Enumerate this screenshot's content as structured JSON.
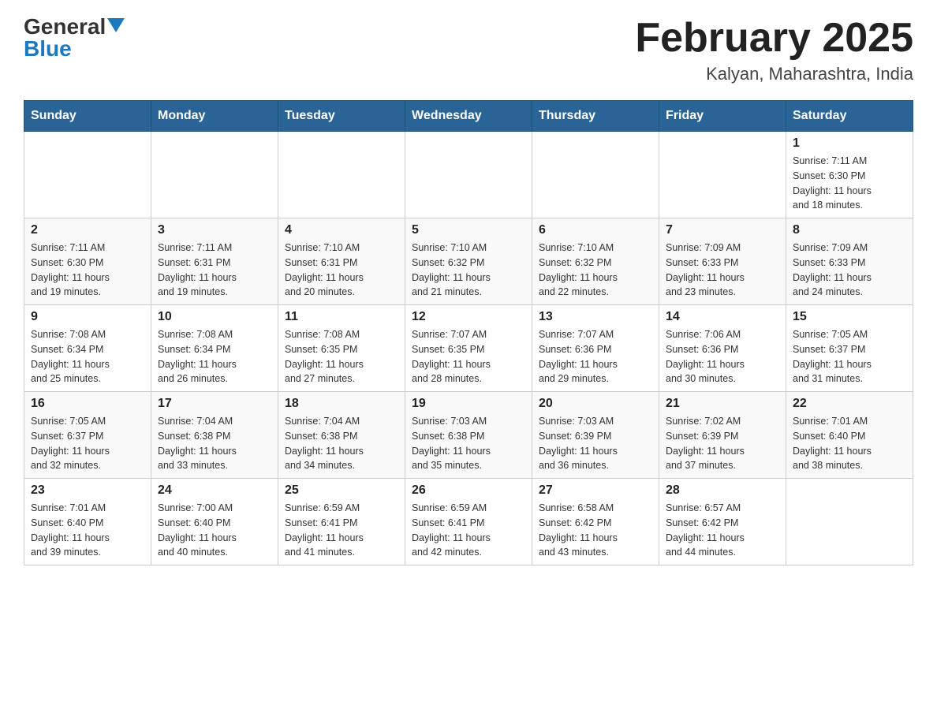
{
  "header": {
    "logo_general": "General",
    "logo_blue": "Blue",
    "title": "February 2025",
    "subtitle": "Kalyan, Maharashtra, India"
  },
  "days_of_week": [
    "Sunday",
    "Monday",
    "Tuesday",
    "Wednesday",
    "Thursday",
    "Friday",
    "Saturday"
  ],
  "weeks": [
    [
      {
        "day": "",
        "info": ""
      },
      {
        "day": "",
        "info": ""
      },
      {
        "day": "",
        "info": ""
      },
      {
        "day": "",
        "info": ""
      },
      {
        "day": "",
        "info": ""
      },
      {
        "day": "",
        "info": ""
      },
      {
        "day": "1",
        "info": "Sunrise: 7:11 AM\nSunset: 6:30 PM\nDaylight: 11 hours\nand 18 minutes."
      }
    ],
    [
      {
        "day": "2",
        "info": "Sunrise: 7:11 AM\nSunset: 6:30 PM\nDaylight: 11 hours\nand 19 minutes."
      },
      {
        "day": "3",
        "info": "Sunrise: 7:11 AM\nSunset: 6:31 PM\nDaylight: 11 hours\nand 19 minutes."
      },
      {
        "day": "4",
        "info": "Sunrise: 7:10 AM\nSunset: 6:31 PM\nDaylight: 11 hours\nand 20 minutes."
      },
      {
        "day": "5",
        "info": "Sunrise: 7:10 AM\nSunset: 6:32 PM\nDaylight: 11 hours\nand 21 minutes."
      },
      {
        "day": "6",
        "info": "Sunrise: 7:10 AM\nSunset: 6:32 PM\nDaylight: 11 hours\nand 22 minutes."
      },
      {
        "day": "7",
        "info": "Sunrise: 7:09 AM\nSunset: 6:33 PM\nDaylight: 11 hours\nand 23 minutes."
      },
      {
        "day": "8",
        "info": "Sunrise: 7:09 AM\nSunset: 6:33 PM\nDaylight: 11 hours\nand 24 minutes."
      }
    ],
    [
      {
        "day": "9",
        "info": "Sunrise: 7:08 AM\nSunset: 6:34 PM\nDaylight: 11 hours\nand 25 minutes."
      },
      {
        "day": "10",
        "info": "Sunrise: 7:08 AM\nSunset: 6:34 PM\nDaylight: 11 hours\nand 26 minutes."
      },
      {
        "day": "11",
        "info": "Sunrise: 7:08 AM\nSunset: 6:35 PM\nDaylight: 11 hours\nand 27 minutes."
      },
      {
        "day": "12",
        "info": "Sunrise: 7:07 AM\nSunset: 6:35 PM\nDaylight: 11 hours\nand 28 minutes."
      },
      {
        "day": "13",
        "info": "Sunrise: 7:07 AM\nSunset: 6:36 PM\nDaylight: 11 hours\nand 29 minutes."
      },
      {
        "day": "14",
        "info": "Sunrise: 7:06 AM\nSunset: 6:36 PM\nDaylight: 11 hours\nand 30 minutes."
      },
      {
        "day": "15",
        "info": "Sunrise: 7:05 AM\nSunset: 6:37 PM\nDaylight: 11 hours\nand 31 minutes."
      }
    ],
    [
      {
        "day": "16",
        "info": "Sunrise: 7:05 AM\nSunset: 6:37 PM\nDaylight: 11 hours\nand 32 minutes."
      },
      {
        "day": "17",
        "info": "Sunrise: 7:04 AM\nSunset: 6:38 PM\nDaylight: 11 hours\nand 33 minutes."
      },
      {
        "day": "18",
        "info": "Sunrise: 7:04 AM\nSunset: 6:38 PM\nDaylight: 11 hours\nand 34 minutes."
      },
      {
        "day": "19",
        "info": "Sunrise: 7:03 AM\nSunset: 6:38 PM\nDaylight: 11 hours\nand 35 minutes."
      },
      {
        "day": "20",
        "info": "Sunrise: 7:03 AM\nSunset: 6:39 PM\nDaylight: 11 hours\nand 36 minutes."
      },
      {
        "day": "21",
        "info": "Sunrise: 7:02 AM\nSunset: 6:39 PM\nDaylight: 11 hours\nand 37 minutes."
      },
      {
        "day": "22",
        "info": "Sunrise: 7:01 AM\nSunset: 6:40 PM\nDaylight: 11 hours\nand 38 minutes."
      }
    ],
    [
      {
        "day": "23",
        "info": "Sunrise: 7:01 AM\nSunset: 6:40 PM\nDaylight: 11 hours\nand 39 minutes."
      },
      {
        "day": "24",
        "info": "Sunrise: 7:00 AM\nSunset: 6:40 PM\nDaylight: 11 hours\nand 40 minutes."
      },
      {
        "day": "25",
        "info": "Sunrise: 6:59 AM\nSunset: 6:41 PM\nDaylight: 11 hours\nand 41 minutes."
      },
      {
        "day": "26",
        "info": "Sunrise: 6:59 AM\nSunset: 6:41 PM\nDaylight: 11 hours\nand 42 minutes."
      },
      {
        "day": "27",
        "info": "Sunrise: 6:58 AM\nSunset: 6:42 PM\nDaylight: 11 hours\nand 43 minutes."
      },
      {
        "day": "28",
        "info": "Sunrise: 6:57 AM\nSunset: 6:42 PM\nDaylight: 11 hours\nand 44 minutes."
      },
      {
        "day": "",
        "info": ""
      }
    ]
  ]
}
